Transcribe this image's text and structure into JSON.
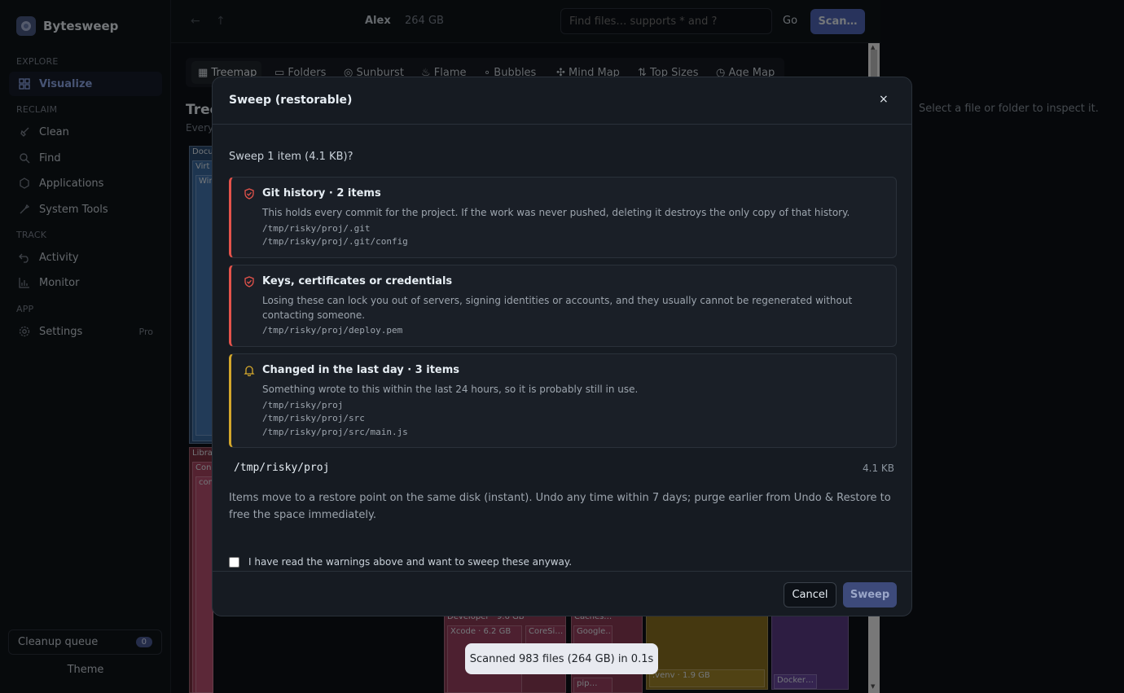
{
  "app": {
    "name": "Bytesweep"
  },
  "sidebar": {
    "sections": {
      "explore": "EXPLORE",
      "reclaim": "RECLAIM",
      "track": "TRACK",
      "app": "APP"
    },
    "items": [
      {
        "label": "Visualize",
        "icon": "grid-icon",
        "active": true
      },
      {
        "label": "Clean",
        "icon": "broom-icon"
      },
      {
        "label": "Find",
        "icon": "search-icon"
      },
      {
        "label": "Applications",
        "icon": "apps-icon"
      },
      {
        "label": "System Tools",
        "icon": "tools-icon"
      },
      {
        "label": "Activity",
        "icon": "undo-icon"
      },
      {
        "label": "Monitor",
        "icon": "bar-chart-icon"
      },
      {
        "label": "Settings",
        "icon": "gear-icon",
        "badge": "Pro"
      }
    ],
    "queue": {
      "label": "Cleanup queue",
      "count": "0"
    },
    "theme": "Theme"
  },
  "topbar": {
    "user": "Alex",
    "size": "264 GB",
    "search_placeholder": "Find files… supports * and ?",
    "go": "Go",
    "scan": "Scan…"
  },
  "tabs": [
    "Treemap",
    "Folders",
    "Sunburst",
    "Flame",
    "Bubbles",
    "Mind Map",
    "Top Sizes",
    "Age Map"
  ],
  "main": {
    "title": "Tree",
    "subtitle": "Every",
    "treemap_labels": {
      "documents": "Docu",
      "virtual": "Virt",
      "win": "Win",
      "library": "Libra",
      "con": "Con",
      "com": "com",
      "developer": "Developer · 9.6 GB",
      "xcode": "Xcode · 6.2 GB",
      "coresim": "CoreSi…",
      "caches": "Caches…",
      "google": "Google…",
      "pip": "pip…",
      "venv": ".venv · 1.9 GB",
      "docker": "Docker…"
    }
  },
  "inspector": {
    "hint": "Select a file or folder to inspect it."
  },
  "toast": "Scanned 983 files (264 GB) in 0.1s",
  "modal": {
    "title": "Sweep (restorable)",
    "close": "×",
    "question": "Sweep 1 item (4.1 KB)?",
    "warnings": [
      {
        "title": "Git history · 2 items",
        "desc": "This holds every commit for the project. If the work was never pushed, deleting it destroys the only copy of that history.",
        "paths": [
          "/tmp/risky/proj/.git",
          "/tmp/risky/proj/.git/config"
        ],
        "level": "danger",
        "color": "#e5534b"
      },
      {
        "title": "Keys, certificates or credentials",
        "desc": "Losing these can lock you out of servers, signing identities or accounts, and they usually cannot be regenerated without contacting someone.",
        "paths": [
          "/tmp/risky/proj/deploy.pem"
        ],
        "level": "danger",
        "color": "#e5534b"
      },
      {
        "title": "Changed in the last day · 3 items",
        "desc": "Something wrote to this within the last 24 hours, so it is probably still in use.",
        "paths": [
          "/tmp/risky/proj",
          "/tmp/risky/proj/src",
          "/tmp/risky/proj/src/main.js"
        ],
        "level": "warning",
        "color": "#d4a72c"
      }
    ],
    "item_path": "/tmp/risky/proj",
    "item_size": "4.1 KB",
    "info": "Items move to a restore point on the same disk (instant). Undo any time within 7 days; purge earlier from Undo & Restore to free the space immediately.",
    "confirm_label": "I have read the warnings above and want to sweep these anyway.",
    "confirm_checked": false,
    "cancel": "Cancel",
    "sweep": "Sweep"
  },
  "colors": {
    "accent": "#5066b8",
    "danger": "#e5534b",
    "warning": "#d4a72c"
  }
}
